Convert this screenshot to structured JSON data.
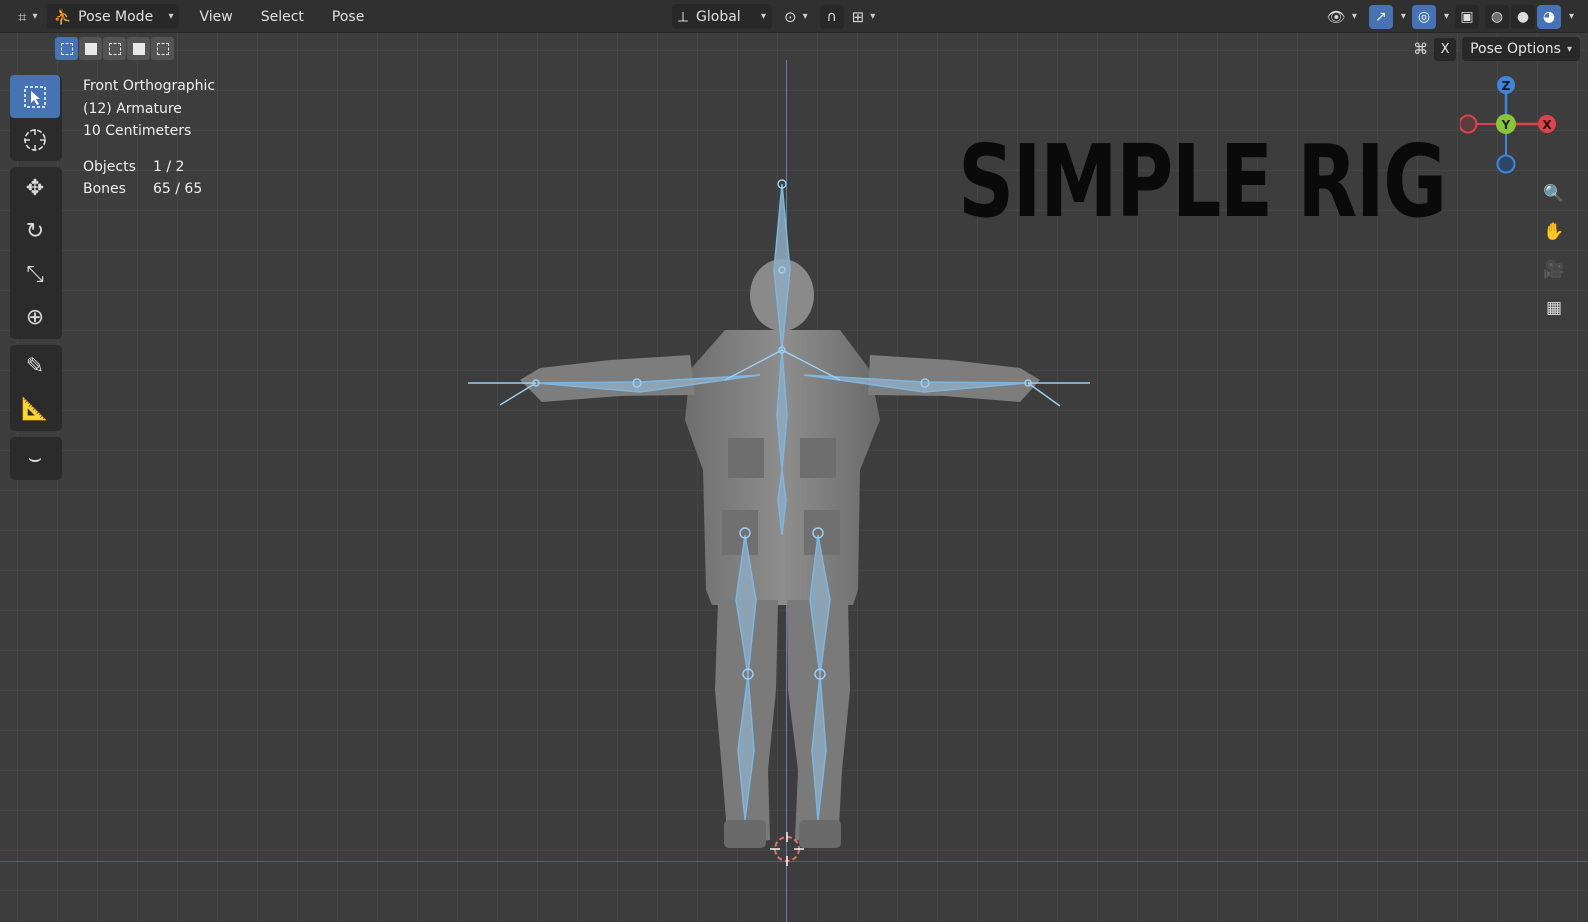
{
  "header": {
    "mode_label": "Pose Mode",
    "menu": [
      "View",
      "Select",
      "Pose"
    ],
    "orientation_label": "Global"
  },
  "subbar": {
    "close_label": "X",
    "pose_options_label": "Pose Options"
  },
  "overlay": {
    "view_name": "Front Orthographic",
    "object_name": "(12) Armature",
    "grid_scale": "10 Centimeters",
    "stats": [
      {
        "label": "Objects",
        "value": "1 / 2"
      },
      {
        "label": "Bones",
        "value": "65 / 65"
      }
    ]
  },
  "gizmo": {
    "z_label": "Z",
    "y_label": "Y",
    "x_label": "X"
  },
  "viewport_text": "SIMPLE RIG",
  "colors": {
    "accent": "#4772b3",
    "bone": "#7fb6e0",
    "x_axis": "#e0424d",
    "y_axis": "#8ac43a",
    "z_axis": "#3f86d8"
  }
}
